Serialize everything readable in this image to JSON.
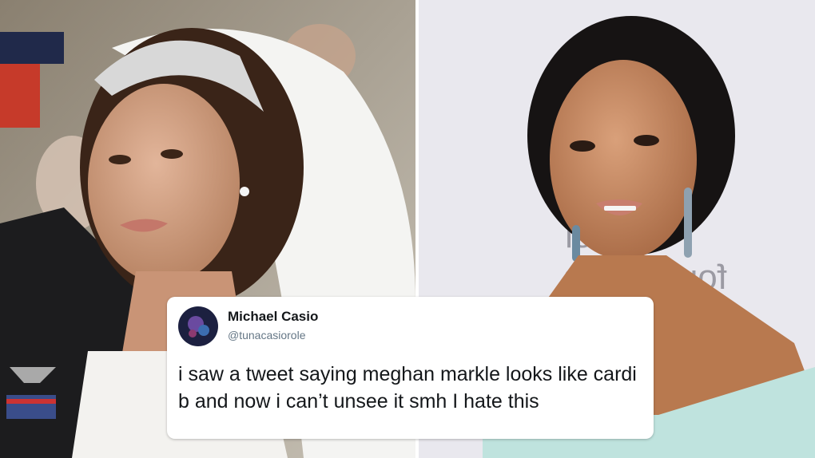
{
  "left_photo": {
    "description_icon": "bride-photo"
  },
  "right_photo": {
    "description_icon": "celebrity-photo",
    "backdrop_text_line1": "lionel",
    "backdrop_text_line2": "foundation"
  },
  "tweet": {
    "author_name": "Michael Casio",
    "author_handle": "@tunacasiorole",
    "text": "i saw a tweet saying meghan markle looks like cardi b and now i can’t unsee it smh I hate this"
  },
  "colors": {
    "tweet_bg": "#ffffff",
    "name": "#14171a",
    "handle": "#657786",
    "backdrop": "#e9e8ee"
  }
}
